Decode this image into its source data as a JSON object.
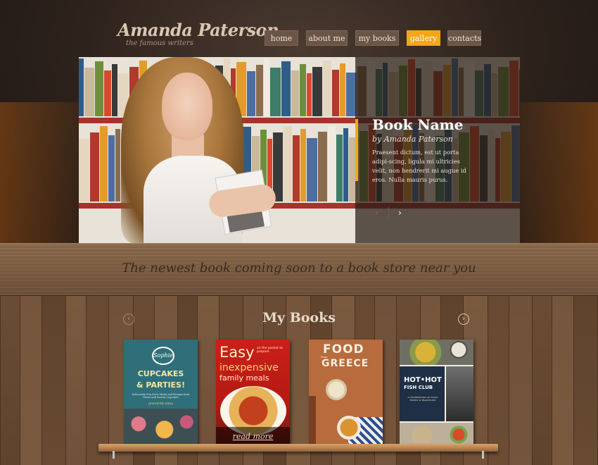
{
  "header": {
    "logo_title": "Amanda Paterson",
    "logo_subtitle": "the famous writers"
  },
  "nav": {
    "items": [
      {
        "label": "home",
        "active": false
      },
      {
        "label": "about me",
        "active": false
      },
      {
        "label": "my books",
        "active": false
      },
      {
        "label": "gallery",
        "active": true
      },
      {
        "label": "contacts",
        "active": false
      }
    ]
  },
  "hero": {
    "book_title": "Book Name",
    "book_author": "by Amanda Paterson",
    "description": "Praesent dictum, est ut porta adipi-scing, ligula mi ultricies velit, non hendrerit mi augue id eros. Nulla mauris purus.",
    "prev_icon": "‹",
    "next_icon": "›"
  },
  "banner": {
    "text": "The newest book coming soon to a book store near you"
  },
  "my_books": {
    "title": "My Books",
    "prev_icon": "‹",
    "next_icon": "›",
    "read_more": "read more",
    "covers": [
      {
        "line1": "CUPCAKES",
        "line2": "& PARTIES!",
        "badge": "Sophie",
        "blurb": "Deliciously Fun Party Meals and Recipes from Sweet and Savory Cupcakes",
        "author": "JENNIFER SHEA"
      },
      {
        "line1": "Easy",
        "line1_small": "on the pocket to prepare",
        "line2": "inexpensive",
        "line3": "family meals"
      },
      {
        "line1": "FOOD",
        "line2": "from",
        "line3": "GREECE"
      },
      {
        "line1": "HOT•HOT",
        "line2": "FISH CLUB",
        "line3": "A CELEBRATION OF FOOD, FAMILY & TRADITIONS"
      }
    ]
  },
  "colors": {
    "accent": "#f6a614",
    "nav_bg": "#6a5547",
    "title_text": "#d9c6b3"
  }
}
